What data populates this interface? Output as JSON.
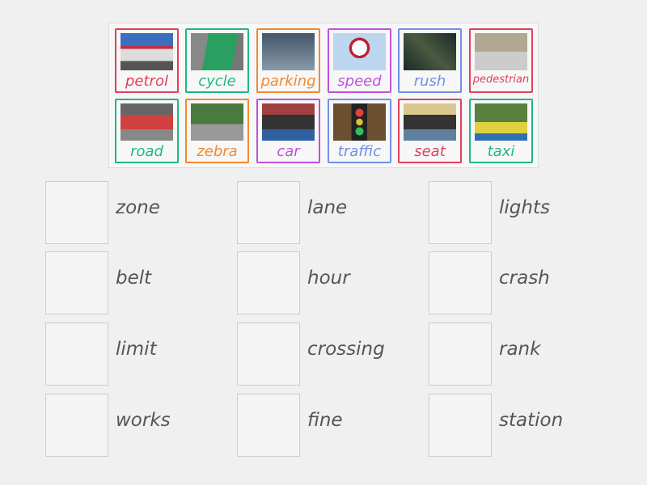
{
  "colors": {
    "red": "#e0405a",
    "green": "#20b880",
    "orange": "#f08a30",
    "purple": "#c050e0",
    "blue": "#7090e8"
  },
  "cards": [
    {
      "label": "petrol",
      "color": "red",
      "image": "petrol-station"
    },
    {
      "label": "cycle",
      "color": "green",
      "image": "cycle-lane"
    },
    {
      "label": "parking",
      "color": "orange",
      "image": "parking-ticket"
    },
    {
      "label": "speed",
      "color": "purple",
      "image": "speed-limit-sign-30"
    },
    {
      "label": "rush",
      "color": "blue",
      "image": "aerial-traffic"
    },
    {
      "label": "pedestrian",
      "color": "red",
      "image": "pedestrian-street"
    },
    {
      "label": "road",
      "color": "green",
      "image": "road-works"
    },
    {
      "label": "zebra",
      "color": "orange",
      "image": "zebra-crossing"
    },
    {
      "label": "car",
      "color": "purple",
      "image": "car-crash"
    },
    {
      "label": "traffic",
      "color": "blue",
      "image": "traffic-lights"
    },
    {
      "label": "seat",
      "color": "red",
      "image": "seat-belt"
    },
    {
      "label": "taxi",
      "color": "green",
      "image": "taxi-rank"
    }
  ],
  "targets": [
    [
      "zone",
      "lane",
      "lights"
    ],
    [
      "belt",
      "hour",
      "crash"
    ],
    [
      "limit",
      "crossing",
      "rank"
    ],
    [
      "works",
      "fine",
      "station"
    ]
  ]
}
